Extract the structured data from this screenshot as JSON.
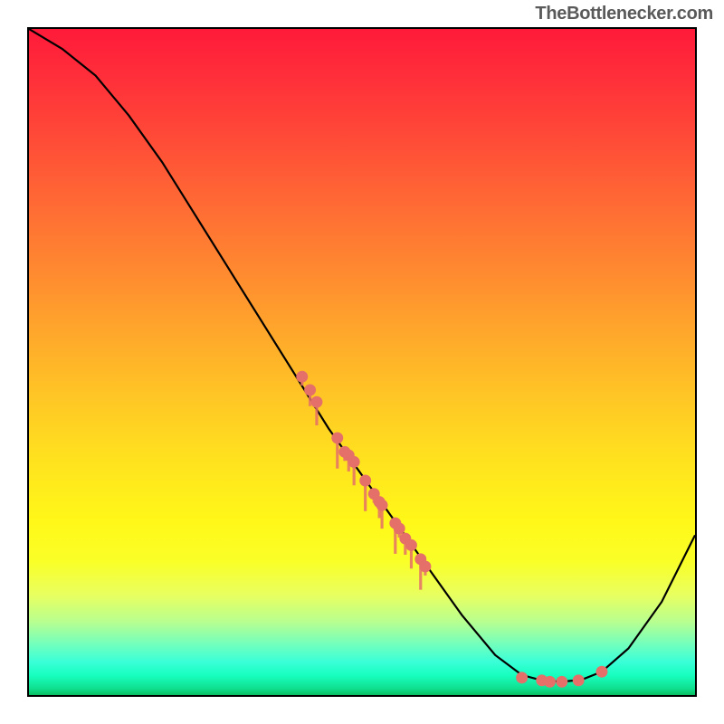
{
  "watermark": "TheBottlenecker.com",
  "chart_data": {
    "type": "line",
    "title": "",
    "xlabel": "",
    "ylabel": "",
    "xlim": [
      0,
      100
    ],
    "ylim": [
      0,
      100
    ],
    "curve": [
      {
        "x": 0,
        "y": 100
      },
      {
        "x": 5,
        "y": 97
      },
      {
        "x": 10,
        "y": 93
      },
      {
        "x": 15,
        "y": 87
      },
      {
        "x": 20,
        "y": 80
      },
      {
        "x": 25,
        "y": 72
      },
      {
        "x": 30,
        "y": 64
      },
      {
        "x": 35,
        "y": 56
      },
      {
        "x": 40,
        "y": 48
      },
      {
        "x": 45,
        "y": 40
      },
      {
        "x": 50,
        "y": 33
      },
      {
        "x": 55,
        "y": 26
      },
      {
        "x": 60,
        "y": 19
      },
      {
        "x": 65,
        "y": 12
      },
      {
        "x": 70,
        "y": 6
      },
      {
        "x": 74,
        "y": 3
      },
      {
        "x": 77,
        "y": 2.2
      },
      {
        "x": 80,
        "y": 2
      },
      {
        "x": 83,
        "y": 2.3
      },
      {
        "x": 86,
        "y": 3.5
      },
      {
        "x": 90,
        "y": 7
      },
      {
        "x": 95,
        "y": 14
      },
      {
        "x": 100,
        "y": 24
      }
    ],
    "left_branch_points": [
      {
        "x": 41.0,
        "y": 47.8
      },
      {
        "x": 42.2,
        "y": 45.8
      },
      {
        "x": 43.2,
        "y": 44.0
      },
      {
        "x": 46.3,
        "y": 38.6
      },
      {
        "x": 47.4,
        "y": 36.5
      },
      {
        "x": 48.0,
        "y": 36.0
      },
      {
        "x": 48.8,
        "y": 35.0
      },
      {
        "x": 50.5,
        "y": 32.2
      },
      {
        "x": 51.8,
        "y": 30.2
      },
      {
        "x": 52.6,
        "y": 29.0
      },
      {
        "x": 53.0,
        "y": 28.5
      },
      {
        "x": 55.0,
        "y": 25.8
      },
      {
        "x": 55.6,
        "y": 25.0
      },
      {
        "x": 56.5,
        "y": 23.5
      },
      {
        "x": 57.4,
        "y": 22.5
      },
      {
        "x": 58.8,
        "y": 20.4
      },
      {
        "x": 59.5,
        "y": 19.3
      }
    ],
    "bottom_points": [
      {
        "x": 74.0,
        "y": 2.6
      },
      {
        "x": 77.0,
        "y": 2.2
      },
      {
        "x": 78.2,
        "y": 2.0
      },
      {
        "x": 80.0,
        "y": 2.0
      },
      {
        "x": 82.5,
        "y": 2.2
      },
      {
        "x": 86.0,
        "y": 3.5
      }
    ],
    "point_color": "#e47069",
    "point_radius": 6.5,
    "drip_color": "#e47069"
  }
}
